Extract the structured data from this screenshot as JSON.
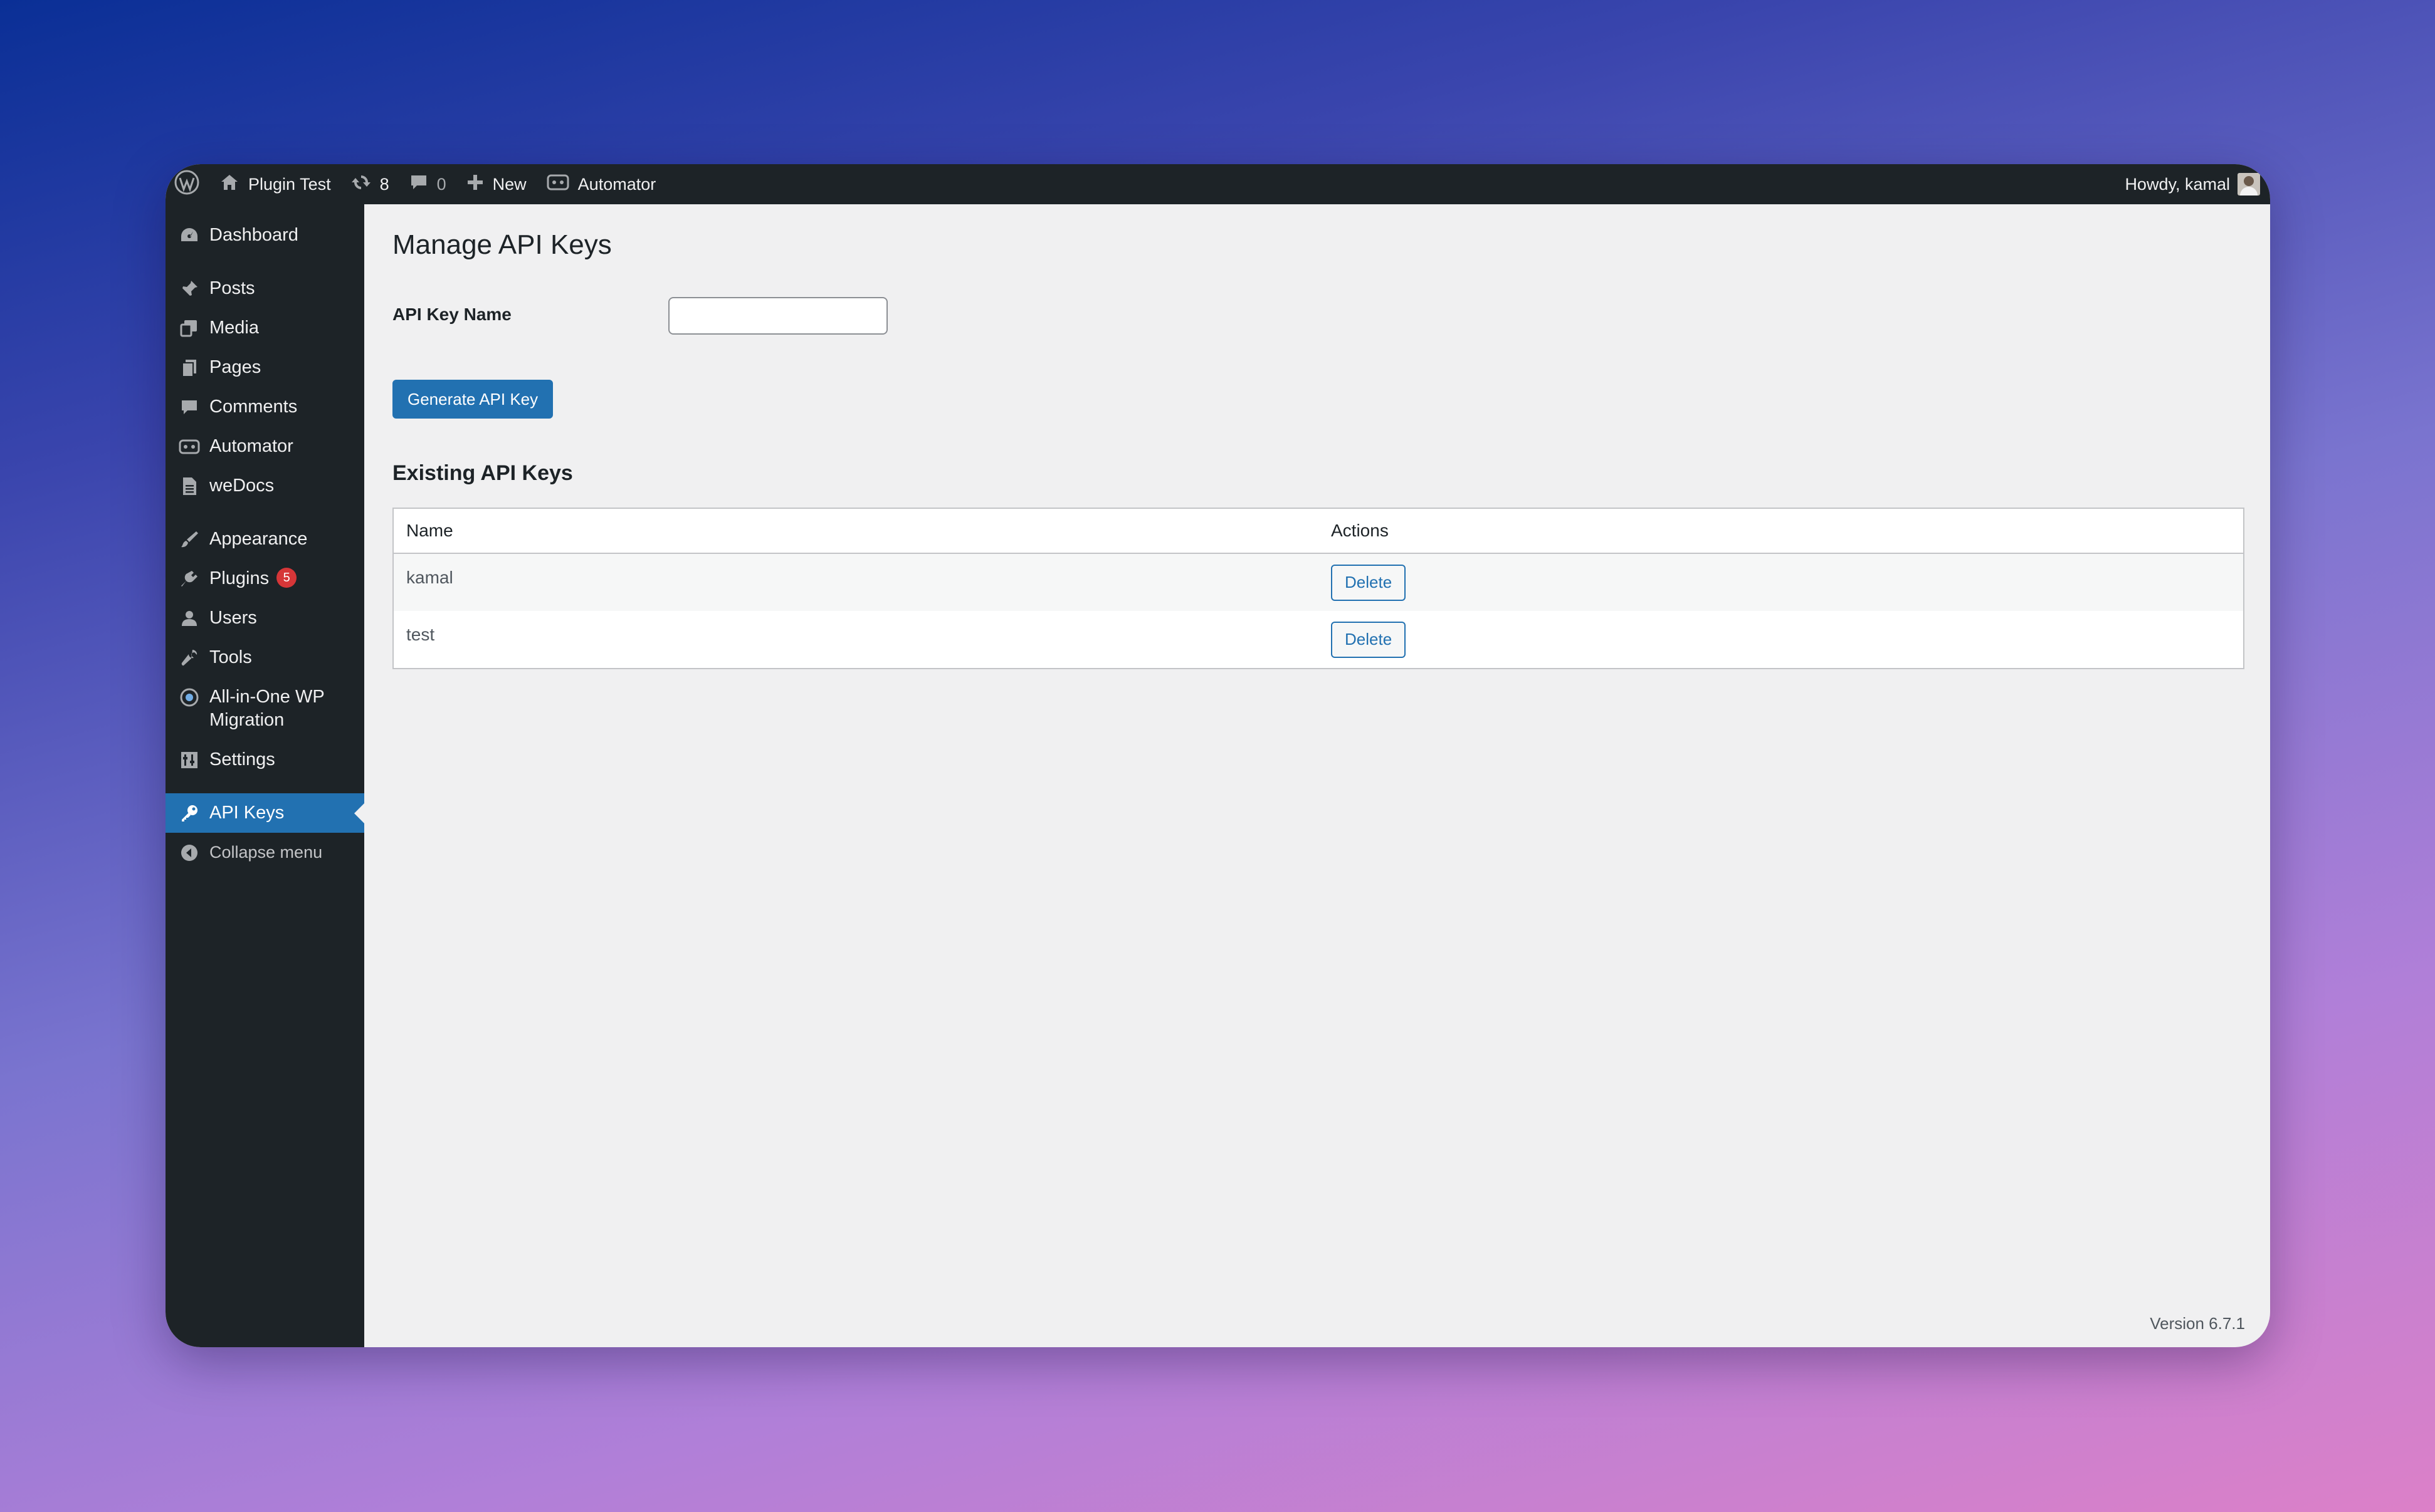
{
  "adminbar": {
    "site_name": "Plugin Test",
    "updates_count": "8",
    "comments_count": "0",
    "new_label": "New",
    "automator_label": "Automator",
    "greeting": "Howdy, kamal"
  },
  "sidebar": {
    "items": [
      {
        "label": "Dashboard",
        "icon": "dashboard-icon"
      },
      {
        "label": "Posts",
        "icon": "pin-icon"
      },
      {
        "label": "Media",
        "icon": "media-icon"
      },
      {
        "label": "Pages",
        "icon": "pages-icon"
      },
      {
        "label": "Comments",
        "icon": "comment-icon"
      },
      {
        "label": "Automator",
        "icon": "robot-icon"
      },
      {
        "label": "weDocs",
        "icon": "document-icon"
      },
      {
        "label": "Appearance",
        "icon": "paintbrush-icon"
      },
      {
        "label": "Plugins",
        "icon": "plugin-icon",
        "badge": "5"
      },
      {
        "label": "Users",
        "icon": "user-icon"
      },
      {
        "label": "Tools",
        "icon": "wrench-icon"
      },
      {
        "label": "All-in-One WP Migration",
        "icon": "migration-icon"
      },
      {
        "label": "Settings",
        "icon": "settings-icon"
      },
      {
        "label": "API Keys",
        "icon": "key-icon",
        "active": true
      }
    ],
    "collapse_label": "Collapse menu"
  },
  "main": {
    "title": "Manage API Keys",
    "form": {
      "label": "API Key Name",
      "value": "",
      "placeholder": "",
      "button_label": "Generate API Key"
    },
    "section_title": "Existing API Keys",
    "table": {
      "headers": [
        "Name",
        "Actions"
      ],
      "rows": [
        {
          "name": "kamal",
          "action": "Delete"
        },
        {
          "name": "test",
          "action": "Delete"
        }
      ]
    }
  },
  "footer": {
    "version": "Version 6.7.1"
  },
  "colors": {
    "accent": "#2271b1",
    "adminbar_bg": "#1d2327",
    "badge": "#d63638"
  }
}
